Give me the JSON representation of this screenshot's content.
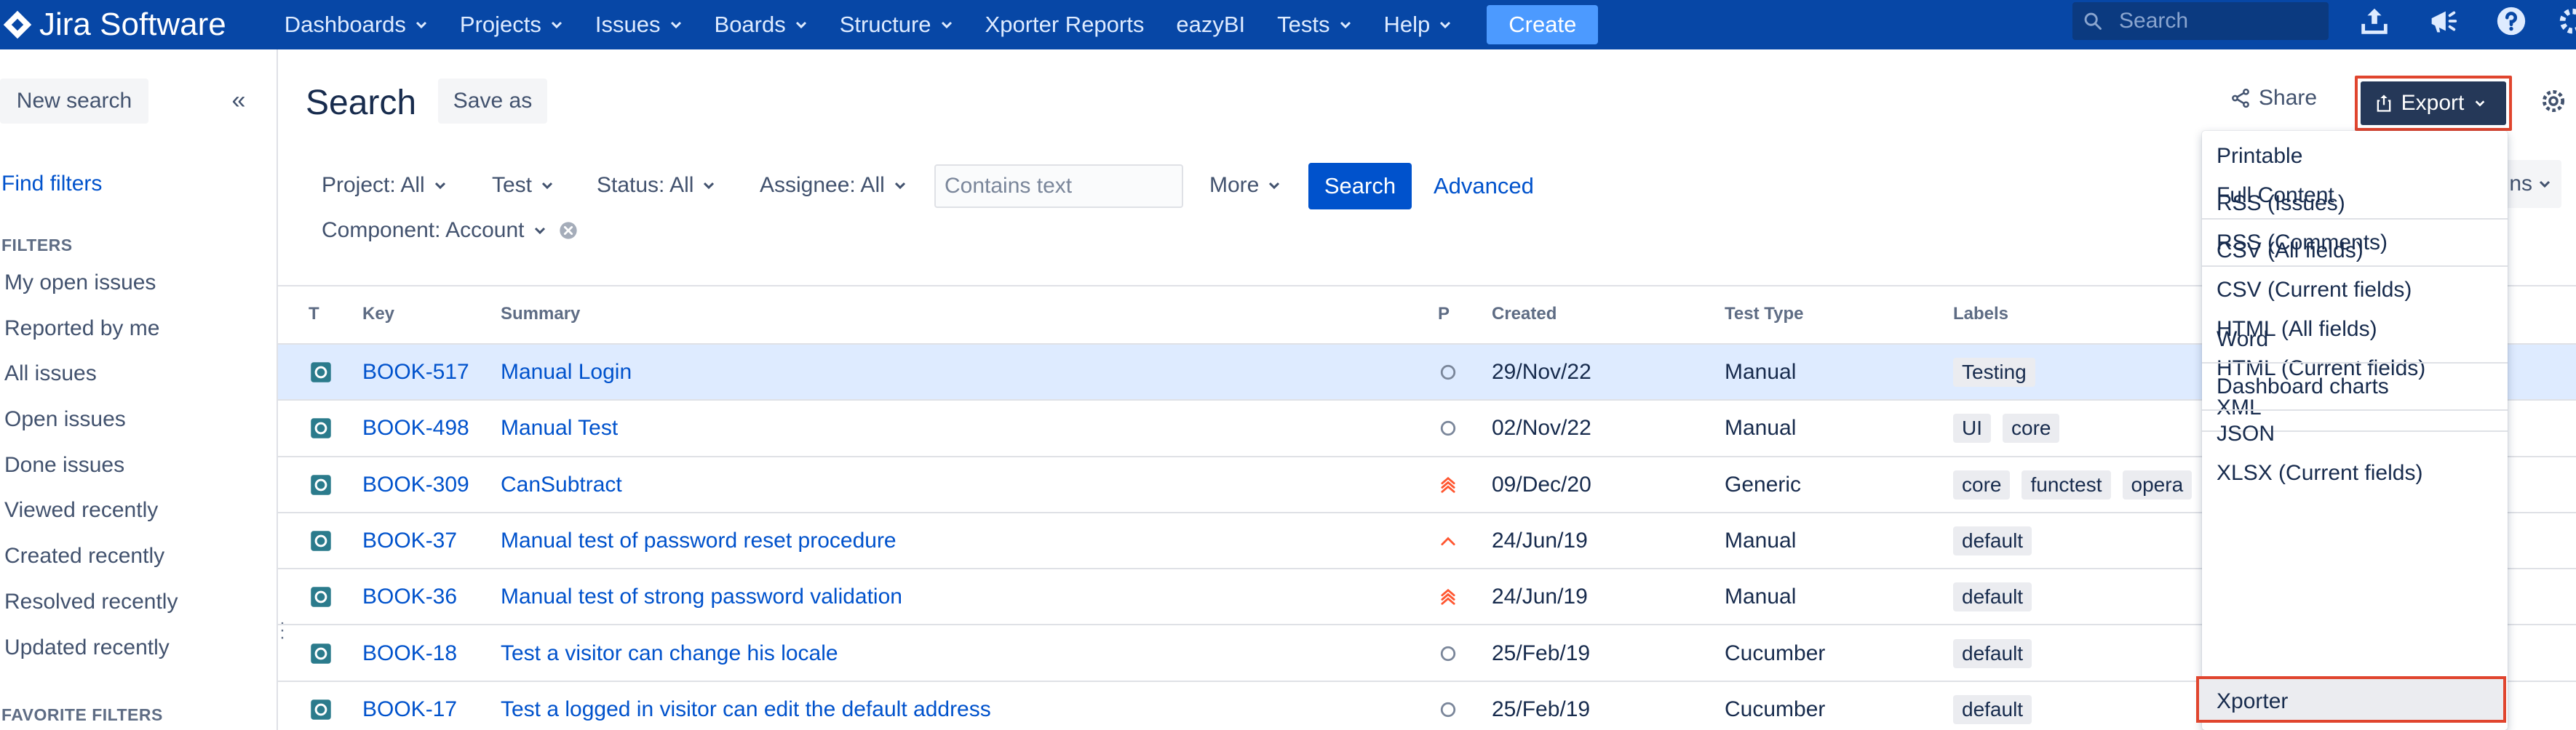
{
  "app": {
    "logo": "Jira Software"
  },
  "topnav": {
    "items": [
      "Dashboards",
      "Projects",
      "Issues",
      "Boards",
      "Structure",
      "Xporter Reports",
      "eazyBI",
      "Tests",
      "Help"
    ],
    "create_label": "Create",
    "search_placeholder": "Search"
  },
  "sidebar": {
    "new_search": "New search",
    "find_filters": "Find filters",
    "filters_heading": "FILTERS",
    "filters": [
      "My open issues",
      "Reported by me",
      "All issues",
      "Open issues",
      "Done issues",
      "Viewed recently",
      "Created recently",
      "Resolved recently",
      "Updated recently"
    ],
    "favorite_heading": "FAVORITE FILTERS"
  },
  "header": {
    "title": "Search",
    "save_as": "Save as",
    "share": "Share",
    "export": "Export"
  },
  "filterbar": {
    "project": "Project: All",
    "test": "Test",
    "status": "Status: All",
    "assignee": "Assignee: All",
    "text_placeholder": "Contains text",
    "more": "More",
    "search_btn": "Search",
    "advanced": "Advanced",
    "component": "Component: Account",
    "columns_partial": "ns"
  },
  "table": {
    "headers": {
      "type": "T",
      "key": "Key",
      "summary": "Summary",
      "priority": "P",
      "created": "Created",
      "test_type": "Test Type",
      "labels": "Labels"
    },
    "rows": [
      {
        "key": "BOOK-517",
        "summary": "Manual Login",
        "priority": "circle",
        "created": "29/Nov/22",
        "test_type": "Manual",
        "labels": [
          "Testing"
        ],
        "selected": true
      },
      {
        "key": "BOOK-498",
        "summary": "Manual Test",
        "priority": "circle",
        "created": "02/Nov/22",
        "test_type": "Manual",
        "labels": [
          "UI",
          "core"
        ],
        "selected": false
      },
      {
        "key": "BOOK-309",
        "summary": "CanSubtract",
        "priority": "highest",
        "created": "09/Dec/20",
        "test_type": "Generic",
        "labels": [
          "core",
          "functest",
          "opera"
        ],
        "selected": false
      },
      {
        "key": "BOOK-37",
        "summary": "Manual test of password reset procedure",
        "priority": "high",
        "created": "24/Jun/19",
        "test_type": "Manual",
        "labels": [
          "default"
        ],
        "selected": false
      },
      {
        "key": "BOOK-36",
        "summary": "Manual test of strong password validation",
        "priority": "highest",
        "created": "24/Jun/19",
        "test_type": "Manual",
        "labels": [
          "default"
        ],
        "selected": false
      },
      {
        "key": "BOOK-18",
        "summary": "Test a visitor can change his locale",
        "priority": "circle",
        "created": "25/Feb/19",
        "test_type": "Cucumber",
        "labels": [
          "default"
        ],
        "selected": false
      },
      {
        "key": "BOOK-17",
        "summary": "Test a logged in visitor can edit the default address",
        "priority": "circle",
        "created": "25/Feb/19",
        "test_type": "Cucumber",
        "labels": [
          "default"
        ],
        "selected": false
      }
    ]
  },
  "export_menu": {
    "groups": [
      [
        "Printable",
        "Full Content"
      ],
      [
        "RSS (Issues)",
        "RSS (Comments)"
      ],
      [
        "CSV (All fields)",
        "CSV (Current fields)",
        "HTML (All fields)",
        "HTML (Current fields)",
        "XML"
      ],
      [
        "Word"
      ],
      [
        "Dashboard charts"
      ],
      [
        "JSON",
        "XLSX (Current fields)",
        "Xporter"
      ]
    ]
  },
  "colors": {
    "nav_bg": "#0747a6",
    "link": "#0052cc",
    "highlight_border": "#e0452e",
    "priority_highest": "#ff5630",
    "selected_row": "#deebff"
  }
}
